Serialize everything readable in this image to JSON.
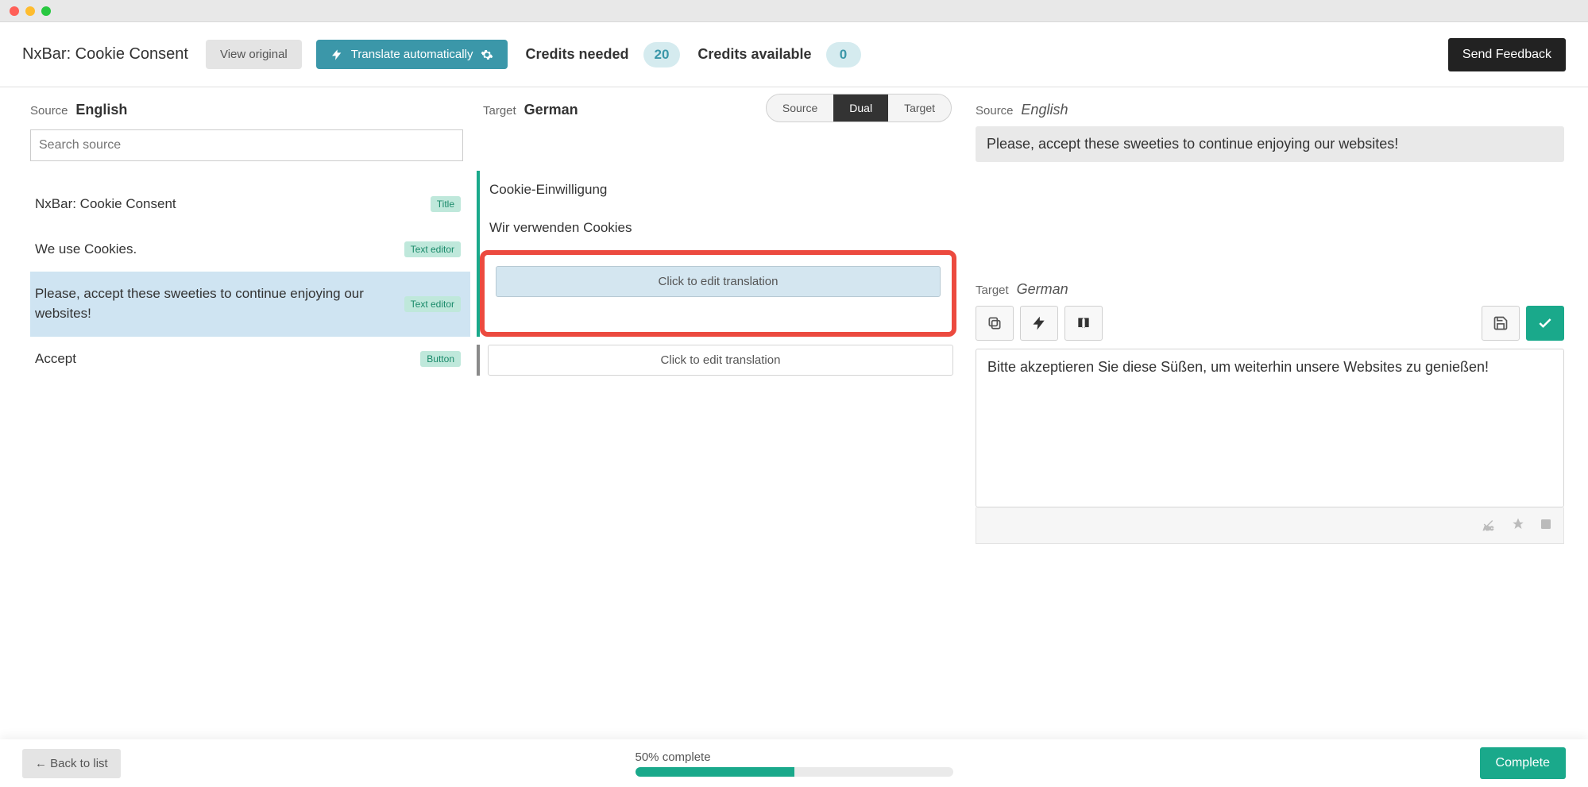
{
  "header": {
    "title": "NxBar: Cookie Consent",
    "view_original": "View original",
    "translate_auto": "Translate automatically",
    "credits_needed_label": "Credits needed",
    "credits_needed_value": "20",
    "credits_available_label": "Credits available",
    "credits_available_value": "0",
    "send_feedback": "Send Feedback"
  },
  "left": {
    "source_label": "Source",
    "source_lang": "English",
    "search_placeholder": "Search source",
    "rows": [
      {
        "text": "NxBar: Cookie Consent",
        "tag": "Title"
      },
      {
        "text": "We use Cookies.",
        "tag": "Text editor"
      },
      {
        "text": "Please, accept these sweeties to continue enjoying our websites!",
        "tag": "Text editor"
      },
      {
        "text": "Accept",
        "tag": "Button"
      }
    ]
  },
  "mid": {
    "target_label": "Target",
    "target_lang": "German",
    "view_modes": {
      "source": "Source",
      "dual": "Dual",
      "target": "Target"
    },
    "translations": [
      "Cookie-Einwilligung",
      "Wir verwenden Cookies"
    ],
    "click_to_edit": "Click to edit translation"
  },
  "right": {
    "source_label": "Source",
    "source_lang": "English",
    "source_text": "Please, accept these sweeties to continue enjoying our websites!",
    "target_label": "Target",
    "target_lang": "German",
    "target_text": "Bitte akzeptieren Sie diese Süßen, um weiterhin unsere Websites zu genießen!"
  },
  "footer": {
    "back": "← Back to list",
    "progress_label": "50% complete",
    "progress_percent": 50,
    "complete": "Complete"
  }
}
